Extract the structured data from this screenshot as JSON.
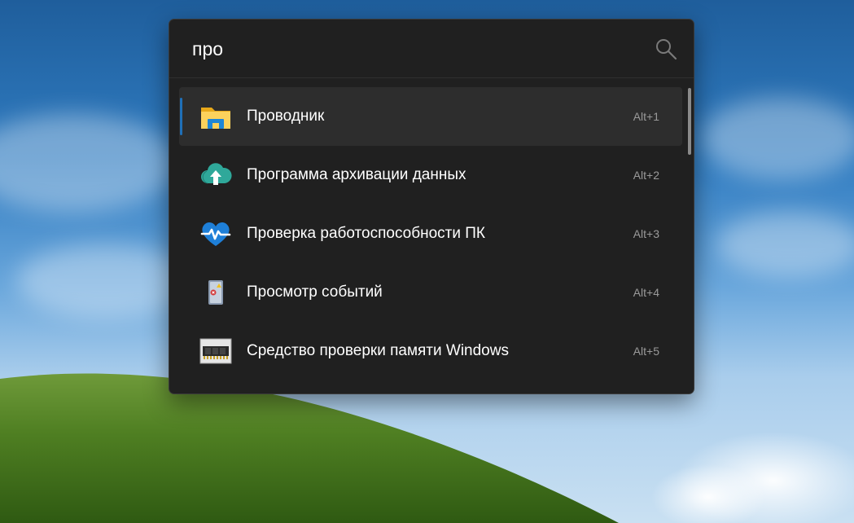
{
  "search": {
    "query": "про",
    "icon": "search-icon"
  },
  "results": [
    {
      "label": "Проводник",
      "shortcut": "Alt+1",
      "icon": "file-explorer-folder-icon",
      "selected": true
    },
    {
      "label": "Программа архивации данных",
      "shortcut": "Alt+2",
      "icon": "cloud-upload-backup-icon",
      "selected": false
    },
    {
      "label": "Проверка работоспособности ПК",
      "shortcut": "Alt+3",
      "icon": "heart-pulse-health-icon",
      "selected": false
    },
    {
      "label": "Просмотр событий",
      "shortcut": "Alt+4",
      "icon": "event-viewer-icon",
      "selected": false
    },
    {
      "label": "Средство проверки памяти Windows",
      "shortcut": "Alt+5",
      "icon": "memory-chip-icon",
      "selected": false
    }
  ],
  "colors": {
    "panel_background": "#202020",
    "selected_row": "#2d2d2d",
    "accent": "#1f6fb7",
    "shortcut_text": "#9a9a9a"
  }
}
